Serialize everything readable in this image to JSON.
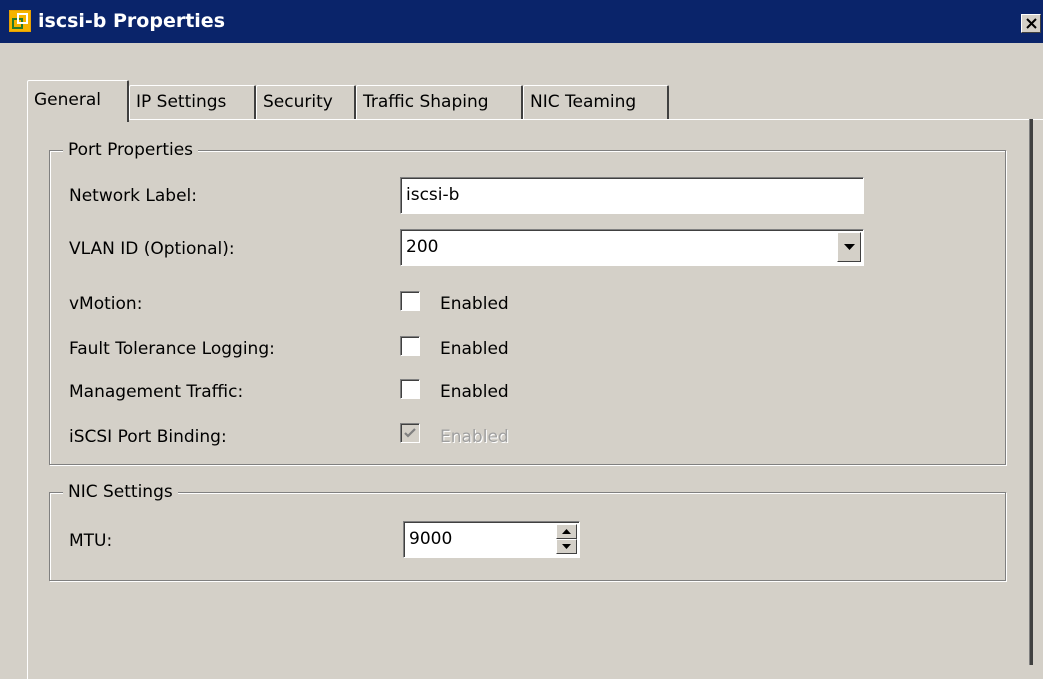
{
  "window": {
    "title": "iscsi-b Properties"
  },
  "tabs": [
    {
      "label": "General",
      "active": true
    },
    {
      "label": "IP Settings",
      "active": false
    },
    {
      "label": "Security",
      "active": false
    },
    {
      "label": "Traffic Shaping",
      "active": false
    },
    {
      "label": "NIC Teaming",
      "active": false
    }
  ],
  "port_properties": {
    "legend": "Port Properties",
    "network_label": {
      "label": "Network Label:",
      "value": "iscsi-b"
    },
    "vlan_id": {
      "label": "VLAN ID (Optional):",
      "value": "200"
    },
    "vmotion": {
      "label": "vMotion:",
      "checkbox_label": "Enabled",
      "checked": false
    },
    "fault_tolerance": {
      "label": "Fault Tolerance Logging:",
      "checkbox_label": "Enabled",
      "checked": false
    },
    "management": {
      "label": "Management Traffic:",
      "checkbox_label": "Enabled",
      "checked": false
    },
    "iscsi_binding": {
      "label": "iSCSI Port Binding:",
      "checkbox_label": "Enabled",
      "checked": true,
      "disabled": true
    }
  },
  "nic_settings": {
    "legend": "NIC Settings",
    "mtu": {
      "label": "MTU:",
      "value": "9000"
    }
  },
  "colors": {
    "titlebar": "#0a246a",
    "dialog_bg": "#d4d0c8"
  }
}
